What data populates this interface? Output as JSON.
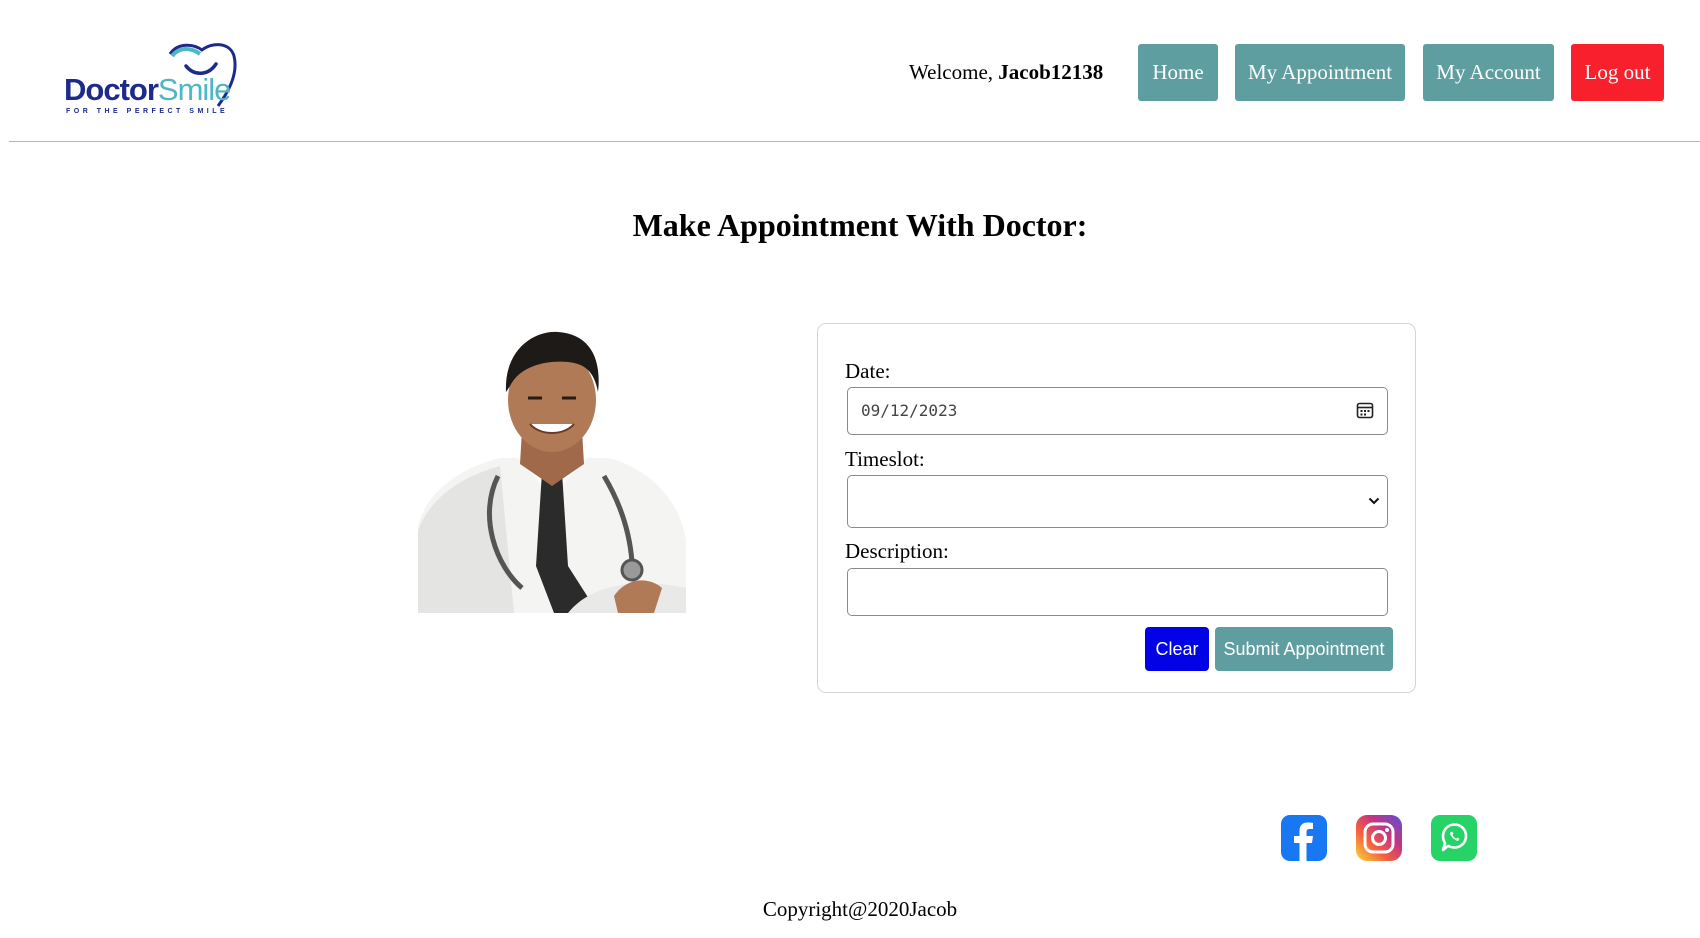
{
  "header": {
    "logo": {
      "word_primary": "Doctor",
      "word_secondary": "Smile",
      "tagline": "FOR THE PERFECT SMILE"
    },
    "welcome_prefix": "Welcome, ",
    "username": "Jacob12138",
    "nav": {
      "home": "Home",
      "my_appointment": "My Appointment",
      "my_account": "My Account",
      "logout": "Log out"
    }
  },
  "main": {
    "title": "Make Appointment With Doctor:",
    "form": {
      "date_label": "Date:",
      "date_value": "09/12/2023",
      "timeslot_label": "Timeslot:",
      "timeslot_value": "",
      "description_label": "Description:",
      "description_value": "",
      "clear_label": "Clear",
      "submit_label": "Submit Appointment"
    }
  },
  "footer": {
    "social_icons": [
      "facebook-icon",
      "instagram-icon",
      "whatsapp-icon"
    ],
    "copyright": "Copyright@2020Jacob"
  },
  "colors": {
    "nav_button": "#5f9ea0",
    "logout_button": "#f7202c",
    "clear_button": "#0202e6",
    "submit_button": "#5f9ea0",
    "logo_primary": "#1c2a8c",
    "logo_secondary": "#4fb6c4"
  }
}
